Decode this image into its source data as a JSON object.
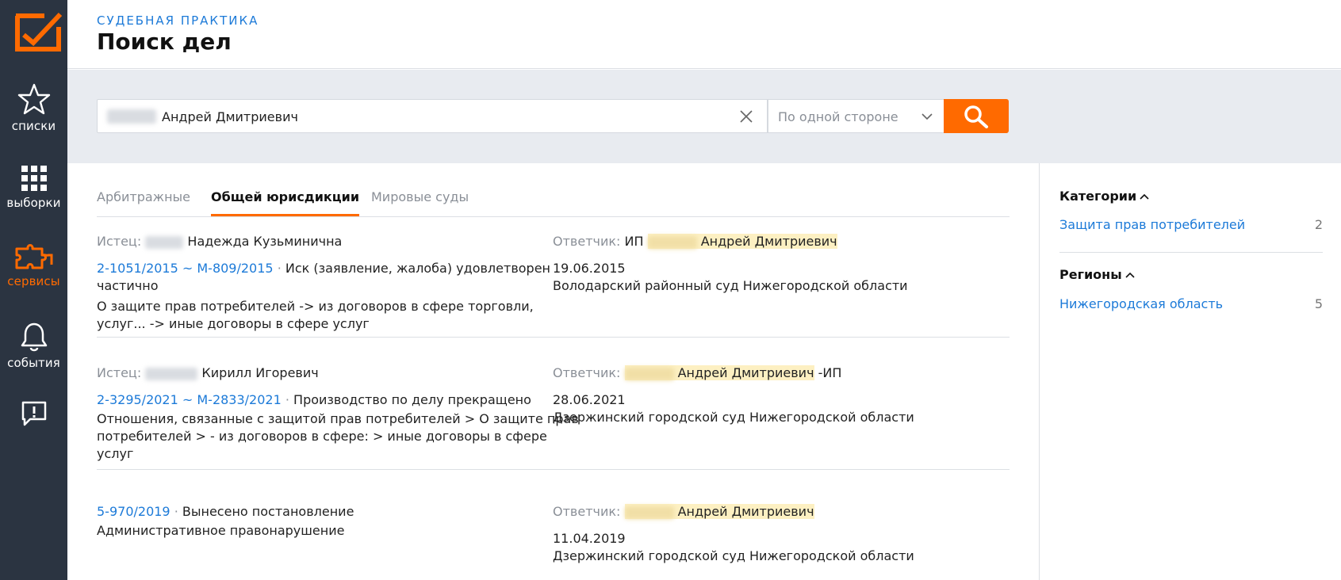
{
  "sidebar": {
    "items": [
      {
        "label": "списки",
        "icon": "star-icon"
      },
      {
        "label": "выборки",
        "icon": "grid-icon"
      },
      {
        "label": "сервисы",
        "icon": "puzzle-icon"
      },
      {
        "label": "события",
        "icon": "bell-icon"
      },
      {
        "label": "",
        "icon": "feedback-icon"
      }
    ],
    "active_color": "#ff6a00"
  },
  "header": {
    "subtitle": "СУДЕБНАЯ ПРАКТИКА",
    "title": "Поиск дел"
  },
  "search": {
    "value": "Андрей Дмитриевич",
    "side_option": "По одной стороне"
  },
  "tabs": [
    {
      "label": "Арбитражные",
      "active": false
    },
    {
      "label": "Общей юрисдикции",
      "active": true
    },
    {
      "label": "Мировые суды",
      "active": false
    }
  ],
  "results": [
    {
      "plaintiff_label": "Истец:",
      "plaintiff_name": "Надежда Кузьминична",
      "case_link": "2-1051/2015 ~ М-809/2015",
      "status_1": "Иск (заявление, жалоба) удовлетворен",
      "status_2": "частично",
      "category_1": "О защите прав потребителей -> из договоров в сфере торговли,",
      "category_2": "услуг... -> иные договоры в сфере услуг",
      "defendant_label": "Ответчик:",
      "defendant_prefix": "ИП",
      "defendant_name": "Андрей Дмитриевич",
      "defendant_suffix": "",
      "date": "19.06.2015",
      "court": "Володарский районный суд Нижегородской области"
    },
    {
      "plaintiff_label": "Истец:",
      "plaintiff_name": "Кирилл Игоревич",
      "case_link": "2-3295/2021 ~ М-2833/2021",
      "status_1": "Производство по делу прекращено",
      "category_1": "Отношения, связанные с защитой прав потребителей > О защите прав",
      "category_2": "потребителей > - из договоров в сфере: > иные договоры в сфере",
      "category_3": "услуг",
      "defendant_label": "Ответчик:",
      "defendant_name": "Андрей Дмитриевич",
      "defendant_suffix": "-ИП",
      "date": "28.06.2021",
      "court": "Дзержинский городской суд Нижегородской области"
    },
    {
      "case_link": "5-970/2019",
      "status_1": "Вынесено постановление",
      "category_1": "Административное правонарушение",
      "defendant_label": "Ответчик:",
      "defendant_name": "Андрей Дмитриевич",
      "date": "11.04.2019",
      "court": "Дзержинский городской суд Нижегородской области"
    }
  ],
  "facets": {
    "categories": {
      "title": "Категории",
      "items": [
        {
          "name": "Защита прав потребителей",
          "count": "2"
        }
      ]
    },
    "regions": {
      "title": "Регионы",
      "items": [
        {
          "name": "Нижегородская область",
          "count": "5"
        }
      ]
    }
  },
  "colors": {
    "accent": "#ff6a00",
    "link": "#1c7ad8",
    "sidebar_bg": "#2b3441",
    "highlight": "#fdf0c2"
  }
}
